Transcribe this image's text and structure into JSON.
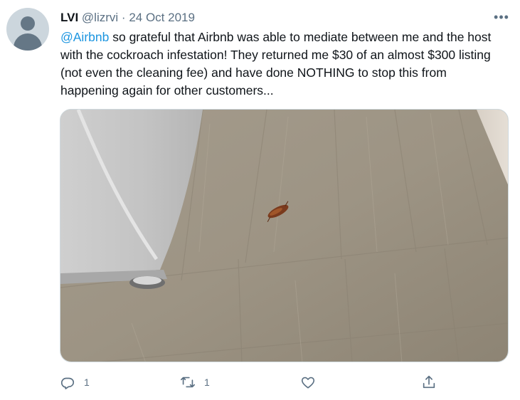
{
  "tweet": {
    "author_name": "LVI",
    "handle": "@lizrvi",
    "separator": "·",
    "date": "24 Oct 2019",
    "more_label": "•••",
    "mention": "@Airbnb",
    "body": " so grateful that Airbnb was able to mediate between me and the host with the cockroach infestation! They returned me $30 of an almost $300 listing (not even the cleaning fee) and have done NOTHING to stop this from happening again for other customers...",
    "media": {
      "description_icon": "photo-of-cockroach-on-wood-floor"
    },
    "actions": {
      "reply_count": "1",
      "retweet_count": "1",
      "like_count": "",
      "share_count": ""
    }
  },
  "colors": {
    "accent": "#1b95e0",
    "secondary_text": "#5b7083",
    "primary_text": "#0f1419"
  },
  "icons": [
    "reply-icon",
    "retweet-icon",
    "like-icon",
    "share-icon",
    "more-icon",
    "avatar-icon"
  ]
}
